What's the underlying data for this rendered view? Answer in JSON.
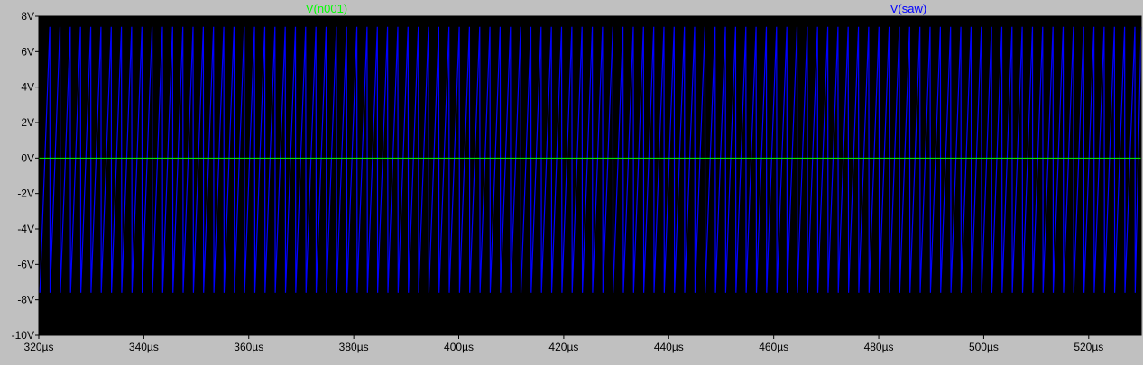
{
  "colors": {
    "background": "#c0c0c0",
    "plot_background": "#000000",
    "axis_line": "#000000",
    "grid": "#808080",
    "trace_n001": "#00ff00",
    "trace_saw": "#0000ff"
  },
  "chart_data": {
    "type": "line",
    "title": "",
    "xlabel": "",
    "ylabel": "",
    "x_unit": "µs",
    "y_unit": "V",
    "xlim": [
      320,
      530
    ],
    "ylim": [
      -10,
      8
    ],
    "x_ticks": [
      320,
      340,
      360,
      380,
      400,
      420,
      440,
      460,
      480,
      500,
      520
    ],
    "y_ticks": [
      8,
      6,
      4,
      2,
      0,
      -2,
      -4,
      -6,
      -8,
      -10
    ],
    "x_tick_labels": [
      "320µs",
      "340µs",
      "360µs",
      "380µs",
      "400µs",
      "420µs",
      "440µs",
      "460µs",
      "480µs",
      "500µs",
      "520µs"
    ],
    "y_tick_labels": [
      "8V",
      "6V",
      "4V",
      "2V",
      "0V",
      "-2V",
      "-4V",
      "-6V",
      "-8V",
      "-10V"
    ],
    "grid": false,
    "legend_placement": "top",
    "series": [
      {
        "name": "V(n001)",
        "color": "#00ff00",
        "shape": "flat",
        "x": [
          320,
          530
        ],
        "values": [
          0,
          0
        ]
      },
      {
        "name": "V(saw)",
        "color": "#0000ff",
        "shape": "sawtooth",
        "x_start": 320.2,
        "x_end": 530,
        "period_us": 1.95,
        "high": 7.4,
        "low": -7.6
      }
    ]
  }
}
